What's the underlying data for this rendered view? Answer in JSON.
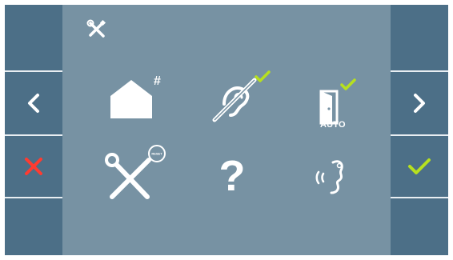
{
  "screen": {
    "title_icon": "wrench-screwdriver-icon"
  },
  "left_column": {
    "buttons": [
      {
        "name": "back-button",
        "icon": "chevron-left-icon"
      },
      {
        "name": "cancel-button",
        "icon": "close-icon",
        "color": "#ff3b30"
      }
    ]
  },
  "right_column": {
    "buttons": [
      {
        "name": "next-button",
        "icon": "chevron-right-icon"
      },
      {
        "name": "confirm-button",
        "icon": "check-icon",
        "color": "#b7e01e"
      }
    ]
  },
  "menu": {
    "items": [
      {
        "name": "home-number",
        "icon": "house-hash-icon",
        "symbol": "#"
      },
      {
        "name": "hearing-loop",
        "icon": "hearing-loop-icon",
        "checked": true
      },
      {
        "name": "auto-door",
        "icon": "door-icon",
        "label": "AUTO",
        "checked": true
      },
      {
        "name": "reset",
        "icon": "tools-reset-icon",
        "badge": "RESET"
      },
      {
        "name": "help",
        "icon": "question-icon",
        "symbol": "?"
      },
      {
        "name": "voice",
        "icon": "voice-icon"
      }
    ]
  },
  "colors": {
    "panel": "#7792a3",
    "side": "#4c6f87",
    "check": "#b7e01e",
    "cancel": "#ff3b30"
  }
}
